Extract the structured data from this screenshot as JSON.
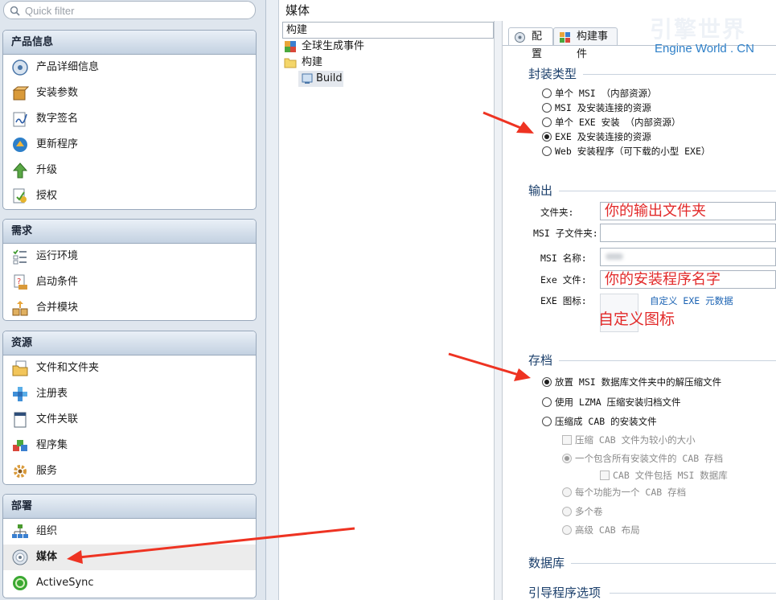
{
  "search": {
    "placeholder": "Quick filter"
  },
  "nav": {
    "groups": [
      {
        "title": "产品信息",
        "items": [
          {
            "label": "产品详细信息",
            "icon": "product-info-icon"
          },
          {
            "label": "安装参数",
            "icon": "package-icon"
          },
          {
            "label": "数字签名",
            "icon": "signature-icon"
          },
          {
            "label": "更新程序",
            "icon": "updater-icon"
          },
          {
            "label": "升级",
            "icon": "upgrade-icon"
          },
          {
            "label": "授权",
            "icon": "license-icon"
          }
        ]
      },
      {
        "title": "需求",
        "items": [
          {
            "label": "运行环境",
            "icon": "checklist-icon"
          },
          {
            "label": "启动条件",
            "icon": "launch-condition-icon"
          },
          {
            "label": "合并模块",
            "icon": "merge-modules-icon"
          }
        ]
      },
      {
        "title": "资源",
        "items": [
          {
            "label": "文件和文件夹",
            "icon": "files-folders-icon"
          },
          {
            "label": "注册表",
            "icon": "registry-icon"
          },
          {
            "label": "文件关联",
            "icon": "file-association-icon"
          },
          {
            "label": "程序集",
            "icon": "assemblies-icon"
          },
          {
            "label": "服务",
            "icon": "services-icon"
          }
        ]
      },
      {
        "title": "部署",
        "items": [
          {
            "label": "组织",
            "icon": "organization-icon"
          },
          {
            "label": "媒体",
            "icon": "media-disc-icon",
            "selected": true
          },
          {
            "label": "ActiveSync",
            "icon": "activesync-icon"
          }
        ]
      }
    ]
  },
  "middle": {
    "title": "媒体",
    "tree_header": "构建",
    "tree": [
      {
        "label": "全球生成事件",
        "icon": "global-build-events-icon"
      },
      {
        "label": "构建",
        "icon": "folder-icon"
      },
      {
        "label": "Build",
        "icon": "build-config-icon"
      }
    ]
  },
  "tabs": [
    {
      "label": "配置",
      "icon": "config-tab-icon",
      "active": true
    },
    {
      "label": "构建事件",
      "icon": "build-events-tab-icon",
      "active": false
    }
  ],
  "watermark": {
    "cn": "引擎世界",
    "en": "Engine World . CN"
  },
  "package_type": {
    "title": "封装类型",
    "options": [
      {
        "label": "单个 MSI （内部资源）",
        "checked": false
      },
      {
        "label": "MSI 及安装连接的资源",
        "checked": false
      },
      {
        "label": "单个 EXE 安装 （内部资源）",
        "checked": false
      },
      {
        "label": "EXE 及安装连接的资源",
        "checked": true
      },
      {
        "label": "Web 安装程序（可下载的小型 EXE）",
        "checked": false
      }
    ]
  },
  "output": {
    "title": "输出",
    "folder_label": "文件夹:",
    "folder_value": "你的输出文件夹",
    "msi_subfolder_label": "MSI 子文件夹:",
    "msi_subfolder_value": "",
    "msi_name_label": "MSI 名称:",
    "msi_name_value": "",
    "exe_file_label": "Exe 文件:",
    "exe_file_value": "你的安装程序名字",
    "exe_icon_label": "EXE 图标:",
    "custom_metadata_link": "自定义 EXE 元数据",
    "icon_annotation": "自定义图标"
  },
  "archive": {
    "title": "存档",
    "options": [
      {
        "label": "放置 MSI 数据库文件夹中的解压缩文件",
        "checked": true
      },
      {
        "label": "使用 LZMA 压缩安装归档文件",
        "checked": false
      },
      {
        "label": "压缩成 CAB 的安装文件",
        "checked": false
      }
    ],
    "cab_smaller": "压缩 CAB 文件为较小的大小",
    "cab_single": "一个包含所有安装文件的 CAB 存档",
    "cab_include_msi": "CAB 文件包括 MSI 数据库",
    "cab_per_feature": "每个功能为一个 CAB 存档",
    "cab_multi_volume": "多个卷",
    "cab_advanced": "高级 CAB 布局"
  },
  "database": {
    "title": "数据库"
  },
  "bootstrapper": {
    "title": "引导程序选项"
  },
  "colors": {
    "annotation": "#e22a2a",
    "arrow": "#ee3322",
    "section_title": "#1b3f6b",
    "link": "#1a62b3"
  }
}
